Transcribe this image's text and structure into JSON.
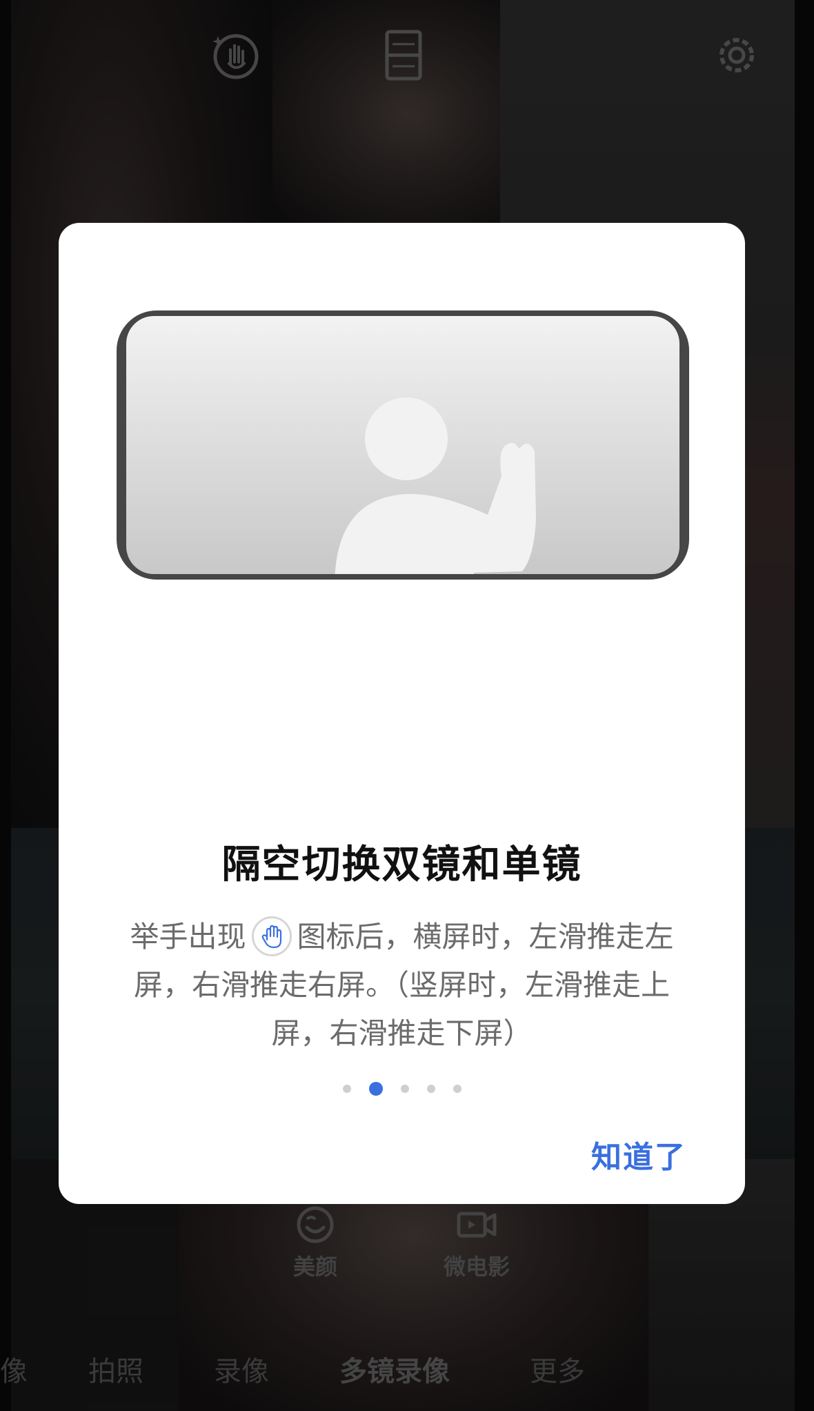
{
  "background": {
    "quick_actions": [
      {
        "label": "美颜",
        "icon": "face-smile-icon"
      },
      {
        "label": "微电影",
        "icon": "video-camera-icon"
      }
    ],
    "modes": [
      {
        "label": "像",
        "active": false
      },
      {
        "label": "拍照",
        "active": false
      },
      {
        "label": "录像",
        "active": false
      },
      {
        "label": "多镜录像",
        "active": true
      },
      {
        "label": "更多",
        "active": false
      }
    ],
    "top_icons": [
      "gesture-hand-icon",
      "dual-view-icon",
      "settings-gear-icon"
    ]
  },
  "dialog": {
    "title": "隔空切换双镜和单镜",
    "desc_part1": "举手出现",
    "desc_part2": "图标后，横屏时，左滑推走左屏，右滑推走右屏。（竖屏时，左滑推走上屏，右滑推走下屏）",
    "inline_icon": "raised-hand-icon",
    "pager": {
      "count": 5,
      "active_index": 1
    },
    "ok_label": "知道了",
    "colors": {
      "accent": "#3a6fe0",
      "title": "#111111",
      "body": "#6b6b6b"
    }
  }
}
